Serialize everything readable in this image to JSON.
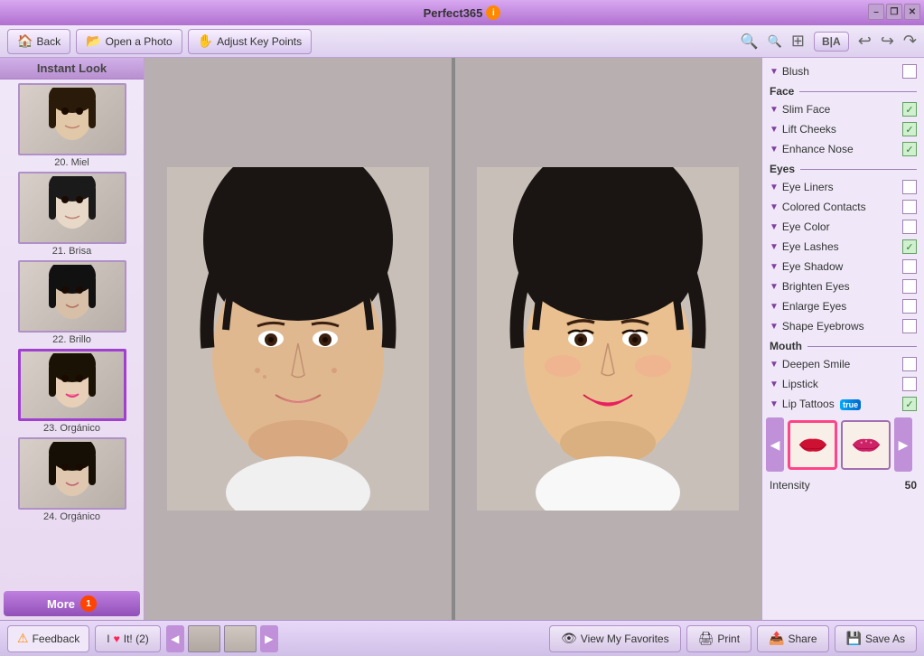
{
  "titlebar": {
    "title": "Perfect365",
    "info_symbol": "i",
    "controls": {
      "minimize": "–",
      "restore": "❐",
      "close": "✕"
    }
  },
  "toolbar": {
    "back_label": "Back",
    "open_photo_label": "Open a Photo",
    "adjust_key_points_label": "Adjust Key Points",
    "zoom_in": "🔍+",
    "zoom_out": "🔍–",
    "fit": "⊞",
    "bia_label": "B|A",
    "undo": "↩",
    "redo_left": "↪",
    "redo_right": "↷"
  },
  "sidebar": {
    "header": "Instant Look",
    "items": [
      {
        "id": 20,
        "label": "20. Miel"
      },
      {
        "id": 21,
        "label": "21. Brisa"
      },
      {
        "id": 22,
        "label": "22. Brillo"
      },
      {
        "id": 23,
        "label": "23. Orgánico"
      },
      {
        "id": 24,
        "label": "24. Orgánico"
      }
    ],
    "more_label": "More",
    "more_badge": "1"
  },
  "right_panel": {
    "blush_label": "Blush",
    "face_section": "Face",
    "face_items": [
      {
        "label": "Slim Face",
        "checked": true
      },
      {
        "label": "Lift Cheeks",
        "checked": true
      },
      {
        "label": "Enhance Nose",
        "checked": true
      }
    ],
    "eyes_section": "Eyes",
    "eyes_items": [
      {
        "label": "Eye Liners",
        "checked": false
      },
      {
        "label": "Colored Contacts",
        "checked": false
      },
      {
        "label": "Eye Color",
        "checked": false
      },
      {
        "label": "Eye Lashes",
        "checked": true
      },
      {
        "label": "Eye Shadow",
        "checked": false
      },
      {
        "label": "Brighten Eyes",
        "checked": false
      },
      {
        "label": "Enlarge Eyes",
        "checked": false
      },
      {
        "label": "Shape Eyebrows",
        "checked": false
      }
    ],
    "mouth_section": "Mouth",
    "mouth_items": [
      {
        "label": "Deepen Smile",
        "checked": false
      },
      {
        "label": "Lipstick",
        "checked": false
      },
      {
        "label": "Lip Tattoos",
        "checked": true,
        "new": true
      }
    ],
    "intensity_label": "Intensity",
    "intensity_value": "50"
  },
  "bottombar": {
    "feedback_label": "Feedback",
    "heart_label": "I",
    "heart_symbol": "♥",
    "it_label": "It! (2)",
    "prev_arrow": "◀",
    "next_arrow": "▶",
    "view_favorites_label": "View My Favorites",
    "print_label": "Print",
    "share_label": "Share",
    "save_as_label": "Save As"
  }
}
